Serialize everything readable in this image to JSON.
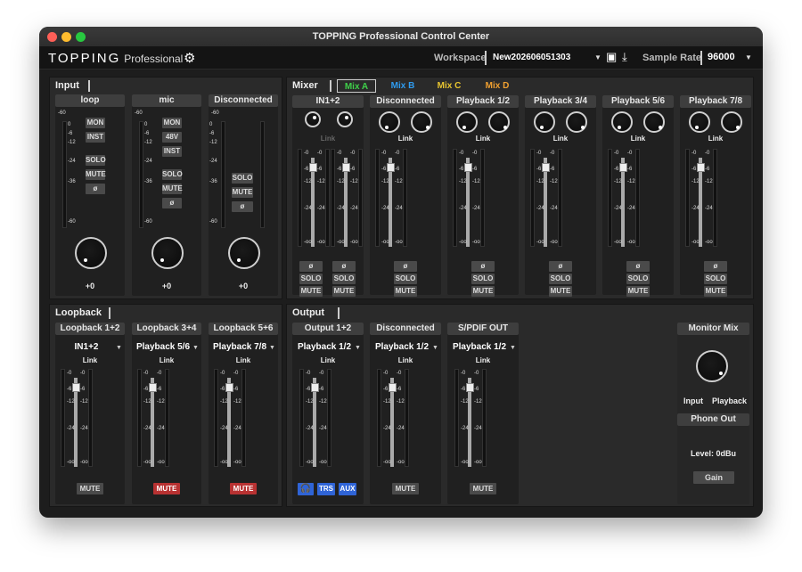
{
  "window": {
    "title": "TOPPING Professional Control Center"
  },
  "toolbar": {
    "brand": "TOPPING",
    "brand_sub": "Professional",
    "workspace_label": "Workspace",
    "workspace_value": "New202606051303",
    "sample_rate_label": "Sample Rate",
    "sample_rate_value": "96000"
  },
  "input": {
    "title": "Input",
    "channels": [
      {
        "name": "loop",
        "value": "+0",
        "buttons": [
          "MON",
          "INST",
          "SOLO",
          "MUTE",
          "ø"
        ]
      },
      {
        "name": "mic",
        "value": "+0",
        "buttons": [
          "MON",
          "48V",
          "INST",
          "SOLO",
          "MUTE",
          "ø"
        ]
      },
      {
        "name": "Disconnected",
        "value": "+0",
        "buttons": [
          "SOLO",
          "MUTE",
          "ø"
        ]
      }
    ],
    "scale": [
      "-60",
      "0",
      "-6",
      "-12",
      "-24",
      "-36",
      "-60"
    ]
  },
  "mixer": {
    "title": "Mixer",
    "tabs": [
      "Mix A",
      "Mix B",
      "Mix C",
      "Mix D"
    ],
    "tab_colors": [
      "#3fd04a",
      "#2f9cf0",
      "#e8c530",
      "#f0a030"
    ],
    "link_label": "Link",
    "channels": [
      "IN1+2",
      "Disconnected",
      "Playback 1/2",
      "Playback 3/4",
      "Playback 5/6",
      "Playback 7/8"
    ],
    "fader_scale": [
      "-0",
      "-6",
      "-12",
      "-24",
      "-oo"
    ],
    "buttons": {
      "phase": "ø",
      "solo": "SOLO",
      "mute": "MUTE"
    }
  },
  "loopback": {
    "title": "Loopback",
    "channels": [
      {
        "name": "Loopback 1+2",
        "source": "IN1+2",
        "mute_active": false
      },
      {
        "name": "Loopback 3+4",
        "source": "Playback 5/6",
        "mute_active": true
      },
      {
        "name": "Loopback 5+6",
        "source": "Playback 7/8",
        "mute_active": true
      }
    ],
    "link_label": "Link",
    "mute_label": "MUTE"
  },
  "output": {
    "title": "Output",
    "channels": [
      {
        "name": "Output 1+2",
        "source": "Playback 1/2"
      },
      {
        "name": "Disconnected",
        "source": "Playback 1/2"
      },
      {
        "name": "S/PDIF OUT",
        "source": "Playback 1/2"
      }
    ],
    "link_label": "Link",
    "mute_label": "MUTE",
    "out_buttons": [
      "TRS",
      "AUX"
    ],
    "monitor_mix": {
      "title": "Monitor Mix",
      "left_label": "Input",
      "right_label": "Playback",
      "phone_out": "Phone Out",
      "level": "Level: 0dBu",
      "gain": "Gain"
    }
  }
}
